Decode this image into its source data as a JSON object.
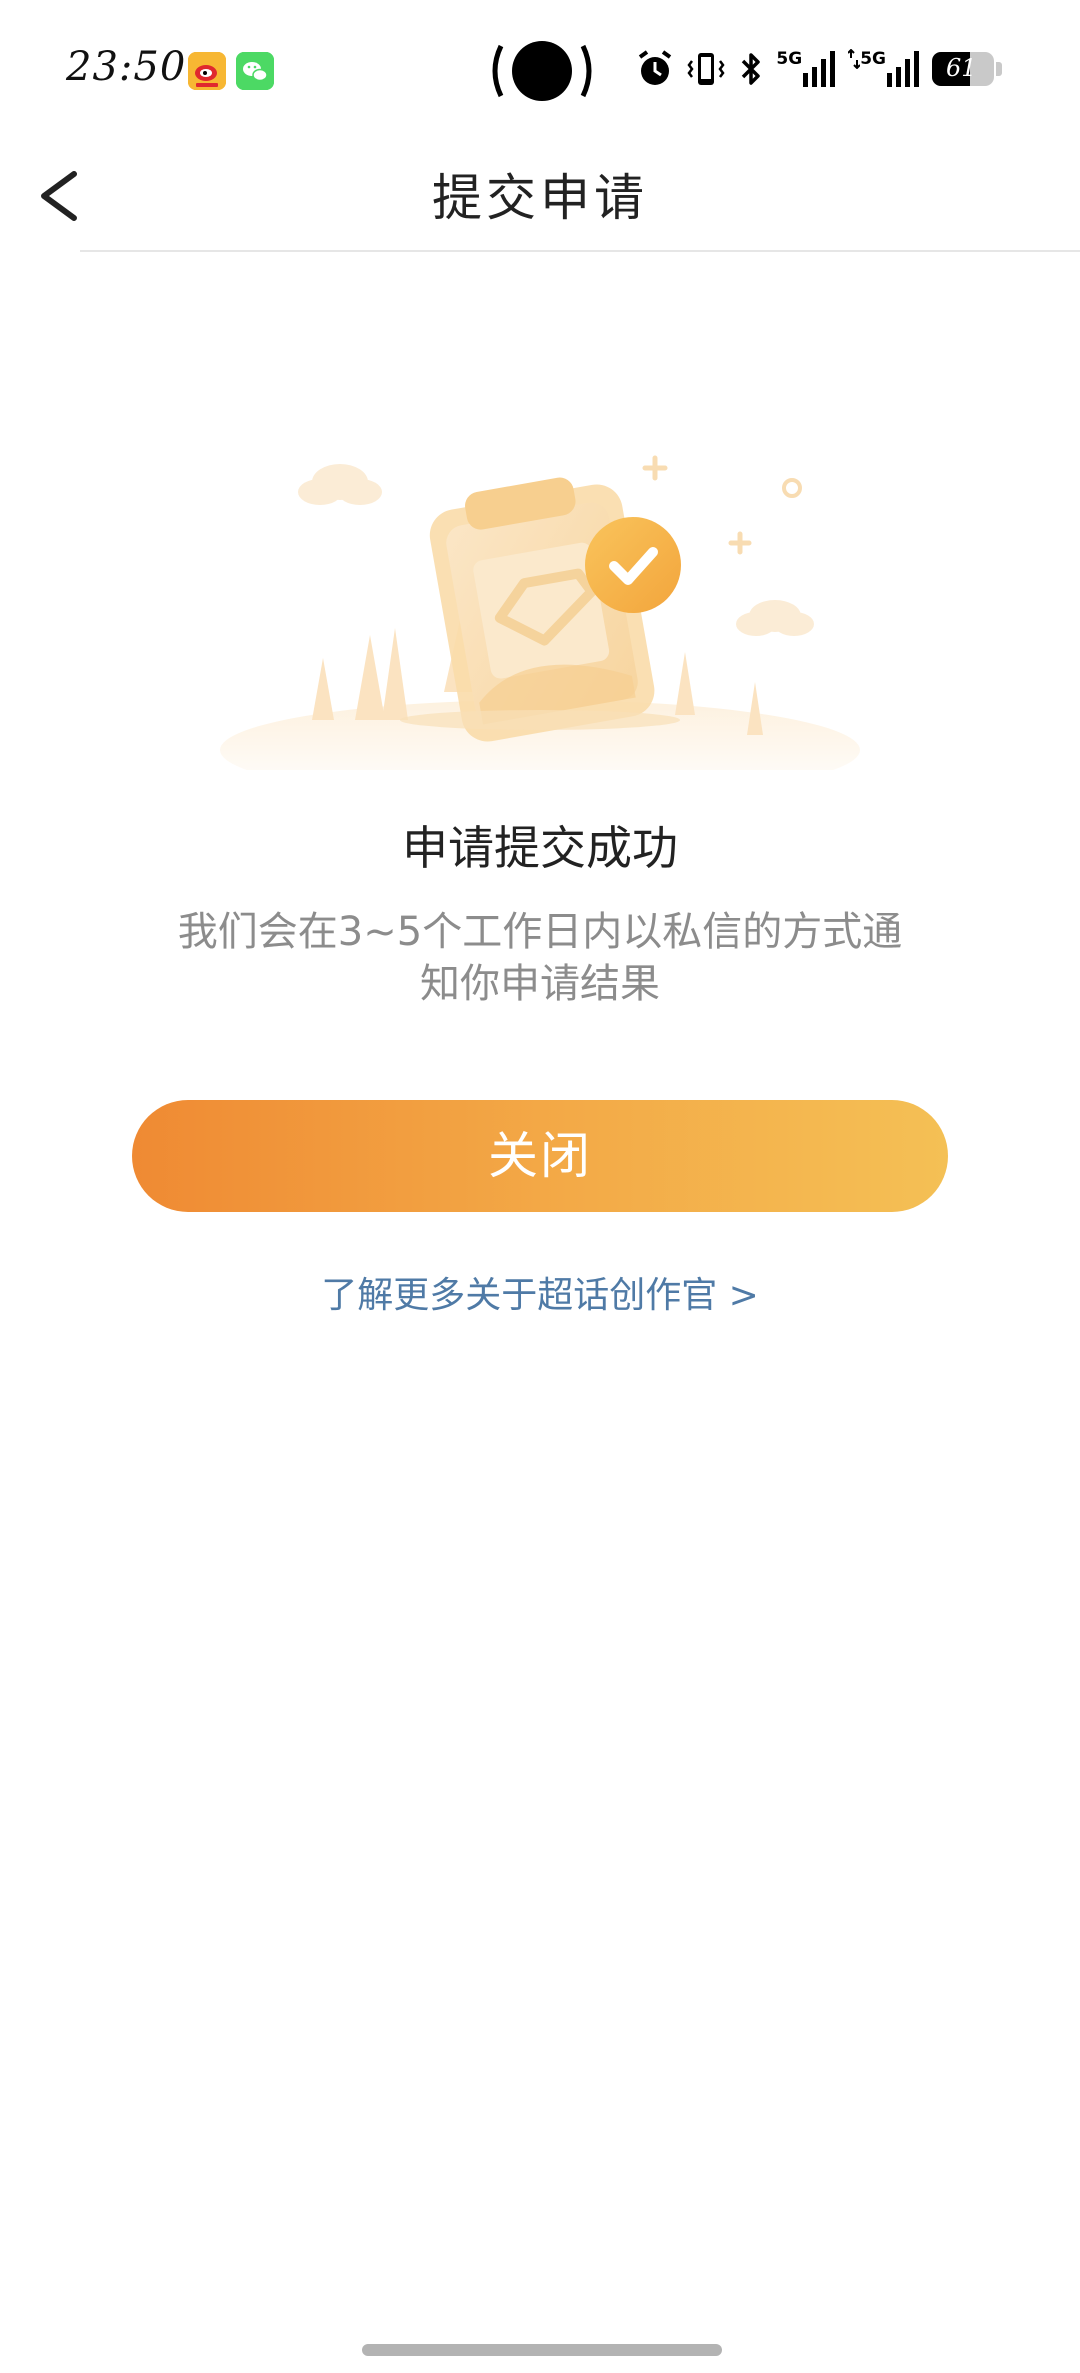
{
  "status_bar": {
    "time": "23:50",
    "network_1": "5G",
    "network_2": "5G",
    "battery_level": "61",
    "battery_fraction": 0.61
  },
  "nav": {
    "title": "提交申请"
  },
  "message": {
    "title": "申请提交成功",
    "description": "我们会在3~5个工作日内以私信的方式通知你申请结果"
  },
  "actions": {
    "close_label": "关闭",
    "learn_more_label": "了解更多关于超话创作官 >"
  },
  "colors": {
    "button_gradient_start": "#ef8a33",
    "button_gradient_end": "#f4c055",
    "link": "#4f7aa6",
    "desc_text": "#8c8c8c"
  },
  "icons": {
    "back": "chevron-left-icon",
    "success": "check-circle-icon",
    "illustration": "clipboard-illustration"
  }
}
